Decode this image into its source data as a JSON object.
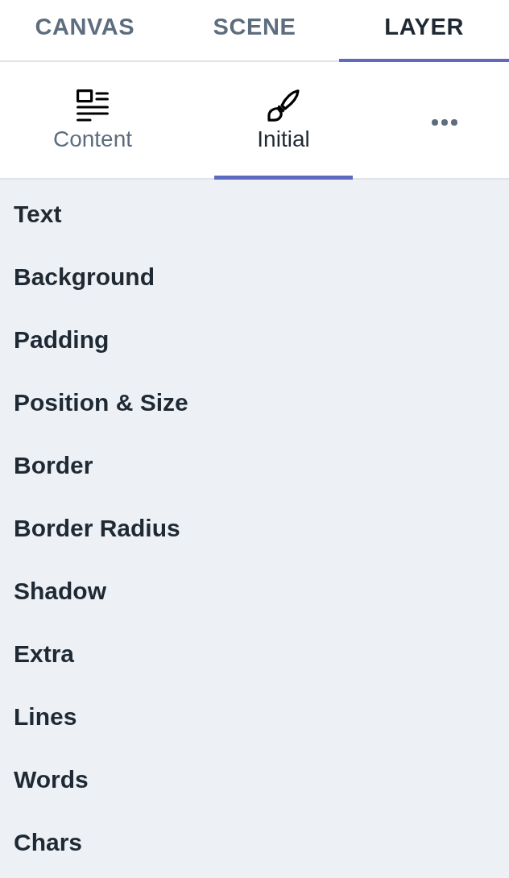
{
  "tabs": [
    {
      "label": "CANVAS",
      "selected": false
    },
    {
      "label": "SCENE",
      "selected": false
    },
    {
      "label": "LAYER",
      "selected": true
    }
  ],
  "sub_tabs": [
    {
      "kind": "labeled",
      "label": "Content",
      "selected": false
    },
    {
      "kind": "labeled",
      "label": "Initial",
      "selected": true
    },
    {
      "kind": "overflow",
      "selected": false
    }
  ],
  "sections": [
    "Text",
    "Background",
    "Padding",
    "Position & Size",
    "Border",
    "Border Radius",
    "Shadow",
    "Extra",
    "Lines",
    "Words",
    "Chars"
  ]
}
